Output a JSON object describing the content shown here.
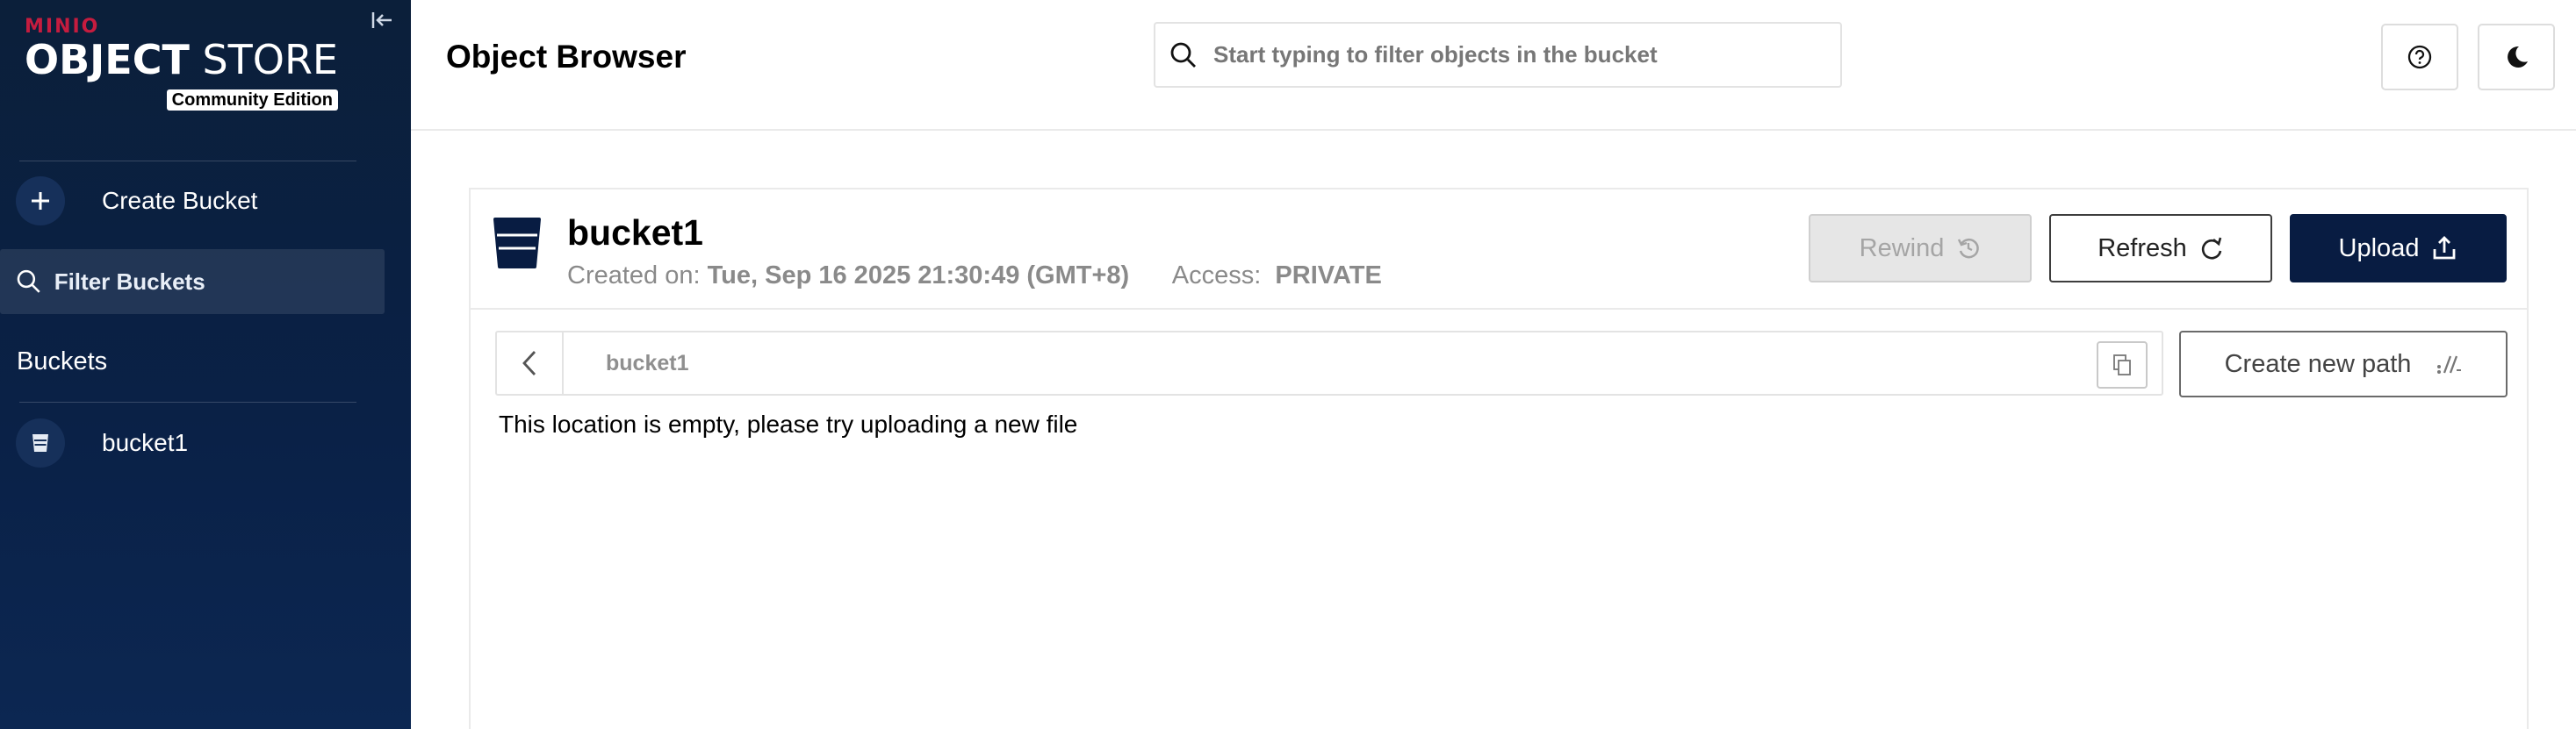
{
  "sidebar": {
    "brand": {
      "minio": "MINIO",
      "title_bold": "OBJECT",
      "title_rest": " STORE",
      "edition": "Community Edition"
    },
    "create_bucket_label": "Create Bucket",
    "filter_placeholder": "Filter Buckets",
    "buckets_heading": "Buckets",
    "buckets": [
      {
        "name": "bucket1"
      }
    ],
    "icons": {
      "collapse": "collapse-sidebar-icon",
      "create": "plus-icon",
      "filter": "search-icon",
      "bucket": "bucket-icon"
    }
  },
  "header": {
    "title": "Object Browser",
    "search_placeholder": "Start typing to filter objects in the bucket",
    "icons": {
      "help": "help-icon",
      "theme": "moon-icon"
    }
  },
  "bucket": {
    "name": "bucket1",
    "created_label": "Created on:",
    "created_value": "Tue, Sep 16 2025 21:30:49 (GMT+8)",
    "access_label": "Access:",
    "access_value": "PRIVATE"
  },
  "actions": {
    "rewind": "Rewind",
    "refresh": "Refresh",
    "upload": "Upload",
    "create_new_path": "Create new path"
  },
  "path": {
    "current": "bucket1"
  },
  "content": {
    "empty_message": "This location is empty, please try uploading a new file"
  },
  "colors": {
    "sidebar_bg": "#0b1f3a",
    "brand_red": "#c51c3f",
    "primary": "#081c42"
  }
}
